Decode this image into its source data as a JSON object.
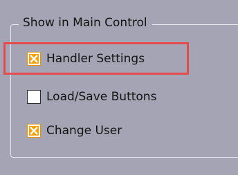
{
  "group": {
    "title": "Show in Main Control"
  },
  "options": [
    {
      "label": "Handler Settings",
      "checked": true
    },
    {
      "label": "Load/Save Buttons",
      "checked": false
    },
    {
      "label": "Change User",
      "checked": true
    }
  ],
  "colors": {
    "background": "#a4a4b4",
    "check_fill": "#f5a200",
    "highlight": "#e44b4b"
  }
}
